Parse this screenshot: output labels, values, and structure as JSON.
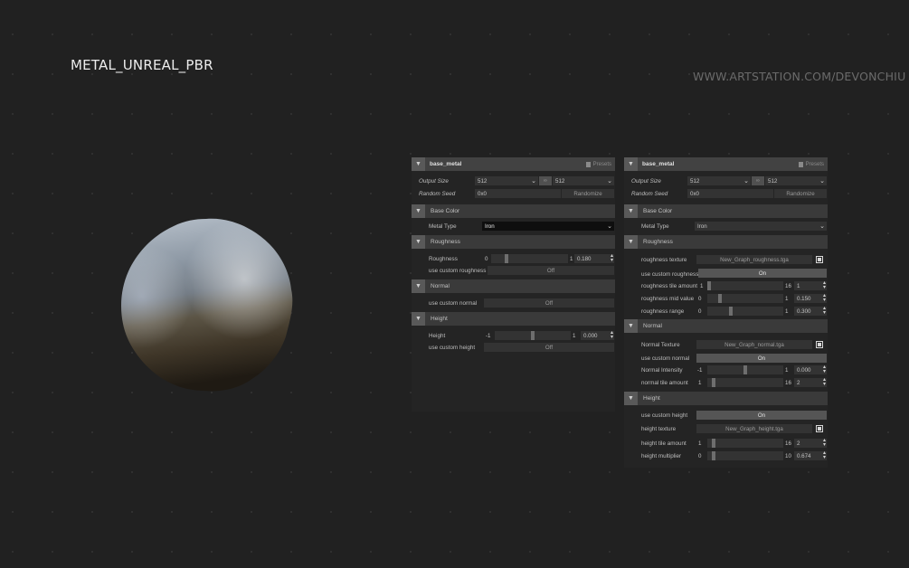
{
  "page": {
    "title": "METAL_UNREAL_PBR",
    "url": "WWW.ARTSTATION.COM/DEVONCHIU"
  },
  "left_panel": {
    "header": "base_metal",
    "presets": "Presets",
    "output_size_label": "Output Size",
    "output_size_w": "512",
    "output_size_h": "512",
    "random_seed_label": "Random Seed",
    "random_seed": "0x0",
    "randomize": "Randomize",
    "base_color": {
      "title": "Base Color",
      "metal_type_label": "Metal Type",
      "metal_type": "Iron"
    },
    "roughness": {
      "title": "Roughness",
      "label": "Roughness",
      "min": "0",
      "max": "1",
      "value": "0.180",
      "fraction": 0.18,
      "custom_label": "use custom roughness",
      "custom_value": "Off"
    },
    "normal": {
      "title": "Normal",
      "custom_label": "use custom normal",
      "custom_value": "Off"
    },
    "height": {
      "title": "Height",
      "label": "Height",
      "min": "-1",
      "max": "1",
      "value": "0.000",
      "fraction": 0.5,
      "custom_label": "use custom height",
      "custom_value": "Off"
    }
  },
  "right_panel": {
    "header": "base_metal",
    "presets": "Presets",
    "output_size_label": "Output Size",
    "output_size_w": "512",
    "output_size_h": "512",
    "random_seed_label": "Random Seed",
    "random_seed": "0x0",
    "randomize": "Randomize",
    "base_color": {
      "title": "Base Color",
      "metal_type_label": "Metal Type",
      "metal_type": "Iron"
    },
    "roughness": {
      "title": "Roughness",
      "texture_label": "roughness texture",
      "texture_file": "New_Graph_roughness.tga",
      "custom_label": "use custom roughness",
      "custom_value": "On",
      "tile_label": "roughness tile amount",
      "tile_min": "1",
      "tile_max": "16",
      "tile_value": "1",
      "tile_fraction": 0.0,
      "mid_label": "roughness mid value",
      "mid_min": "0",
      "mid_max": "1",
      "mid_value": "0.150",
      "mid_fraction": 0.15,
      "range_label": "roughness range",
      "range_min": "0",
      "range_max": "1",
      "range_value": "0.300",
      "range_fraction": 0.3
    },
    "normal": {
      "title": "Normal",
      "texture_label": "Normal Texture",
      "texture_file": "New_Graph_normal.tga",
      "custom_label": "use custom normal",
      "custom_value": "On",
      "intensity_label": "Normal Intensity",
      "intensity_min": "-1",
      "intensity_max": "1",
      "intensity_value": "0.000",
      "intensity_fraction": 0.5,
      "tile_label": "normal tile amount",
      "tile_min": "1",
      "tile_max": "16",
      "tile_value": "2",
      "tile_fraction": 0.066
    },
    "height": {
      "title": "Height",
      "custom_label": "use custom height",
      "custom_value": "On",
      "texture_label": "height texture",
      "texture_file": "New_Graph_height.tga",
      "tile_label": "height tile amount",
      "tile_min": "1",
      "tile_max": "16",
      "tile_value": "2",
      "tile_fraction": 0.066,
      "mult_label": "height multiplier",
      "mult_min": "0",
      "mult_max": "10",
      "mult_value": "0.674",
      "mult_fraction": 0.067
    }
  },
  "icons": {
    "collapse": "chevron-down-icon",
    "presets": "document-icon",
    "dropdown": "chevron-down-icon",
    "stepper": "up-down-arrows-icon",
    "texture_pick": "frame-icon"
  },
  "colors": {
    "background": "#212121",
    "panel": "#242424",
    "header": "#424242",
    "section": "#3a3a3a",
    "field": "#333333",
    "on_toggle": "#555555"
  }
}
